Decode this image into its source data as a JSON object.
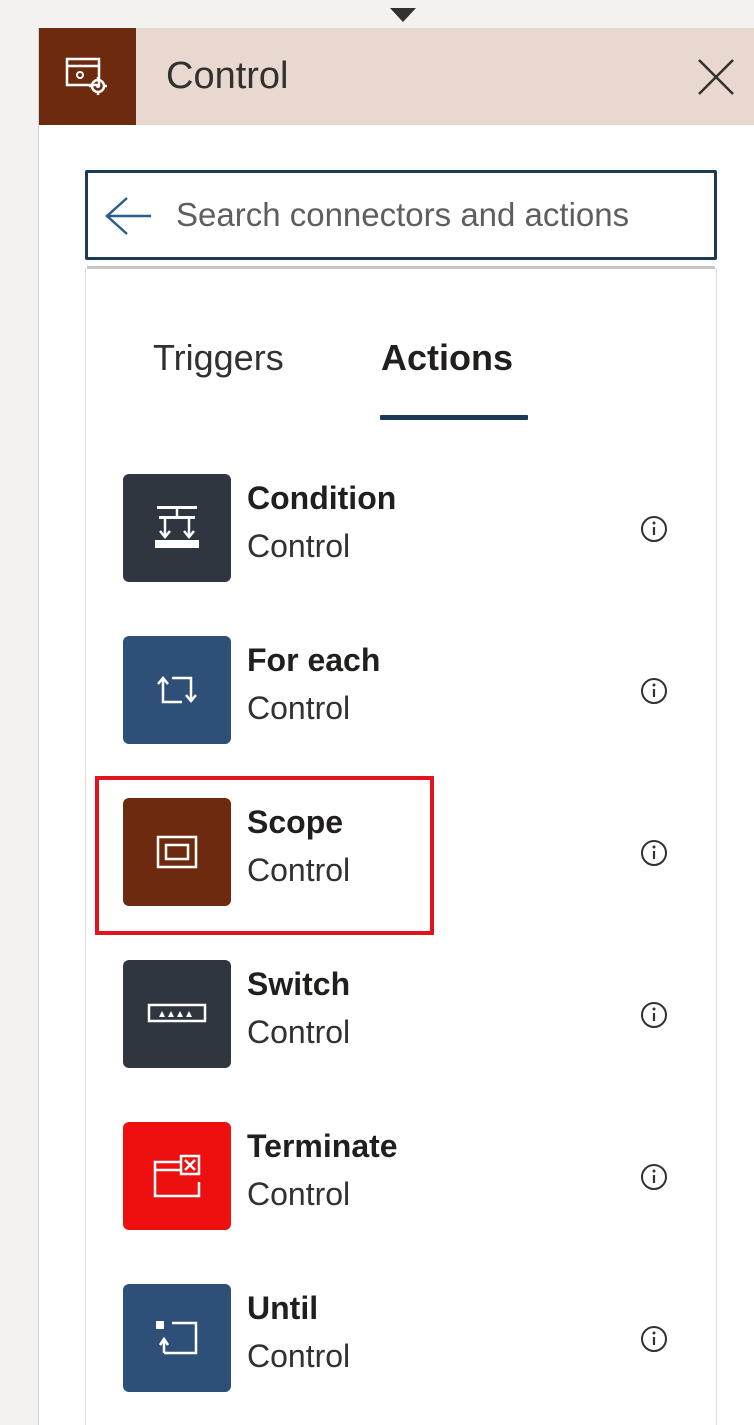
{
  "header": {
    "title": "Control",
    "icon": "control-gear-icon",
    "icon_color": "#6e2a0f"
  },
  "search": {
    "placeholder": "Search connectors and actions",
    "value": ""
  },
  "tabs": [
    {
      "label": "Triggers",
      "selected": false
    },
    {
      "label": "Actions",
      "selected": true
    }
  ],
  "actions": [
    {
      "title": "Condition",
      "subtitle": "Control",
      "icon": "condition-icon",
      "color": "#2f3640"
    },
    {
      "title": "For each",
      "subtitle": "Control",
      "icon": "loop-icon",
      "color": "#2d4f78"
    },
    {
      "title": "Scope",
      "subtitle": "Control",
      "icon": "scope-icon",
      "color": "#6e2a0f",
      "highlighted": true,
      "highlight_color": "#e0131f"
    },
    {
      "title": "Switch",
      "subtitle": "Control",
      "icon": "switch-icon",
      "color": "#2f3640"
    },
    {
      "title": "Terminate",
      "subtitle": "Control",
      "icon": "terminate-icon",
      "color": "#ee0f0f"
    },
    {
      "title": "Until",
      "subtitle": "Control",
      "icon": "until-icon",
      "color": "#2d4f78"
    }
  ]
}
